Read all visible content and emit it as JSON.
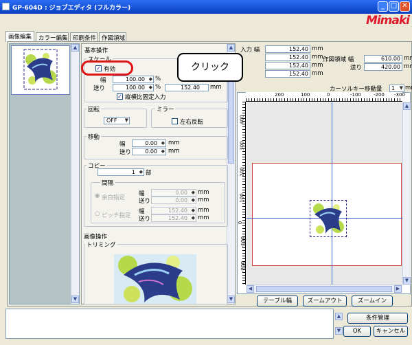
{
  "window": {
    "title": "GP-604D : ジョブエディタ (フルカラー)",
    "brand": "Mimaki"
  },
  "tabs": [
    "画像編集",
    "カラー編集",
    "印刷条件",
    "作図領域"
  ],
  "base_ops": {
    "title": "基本操作",
    "scale_title": "スケール",
    "enable_label": "有効",
    "width_label": "幅",
    "feed_label": "送り",
    "width_value": "100.00",
    "feed_value": "100.00",
    "feed_mm_value": "152.40",
    "unit_pct": "%",
    "unit_mm": "mm",
    "aspect_label": "縦横比固定入力"
  },
  "rotate": {
    "title": "回転",
    "value": "OFF"
  },
  "mirror": {
    "title": "ミラー",
    "label": "左右反転"
  },
  "move": {
    "title": "移動",
    "width_label": "幅",
    "feed_label": "送り",
    "width_value": "0.00",
    "feed_value": "0.00",
    "unit": "mm"
  },
  "copy": {
    "title": "コピー",
    "count": "1",
    "count_unit": "部",
    "gap_title": "間隔",
    "blank_label": "余白指定",
    "pitch_label": "ピッチ指定",
    "width_label": "幅",
    "feed_label": "送り",
    "blank_w": "0.00",
    "blank_f": "0.00",
    "pitch_w": "152.40",
    "pitch_f": "152.40",
    "unit": "mm"
  },
  "image_ops": {
    "title": "画像操作",
    "trimming": "トリミング"
  },
  "info": {
    "input_label": "入力 幅",
    "input_w": "152.40",
    "r2": "152.40",
    "r3": "152.40",
    "r4": "152.40",
    "unit": "mm",
    "area_label": "作図領域 幅",
    "area_w": "610.00",
    "area_feed_label": "送り",
    "area_f": "420.00",
    "cursor_label": "カーソルキー移動量",
    "cursor_value": "1"
  },
  "ruler": {
    "top": [
      "200",
      "100",
      "0",
      "-100",
      "-200",
      "-300"
    ],
    "left": [
      "400",
      "300",
      "200",
      "100",
      "0",
      "-100",
      "-200"
    ]
  },
  "preview_buttons": [
    "テーブル幅",
    "ズームアウト",
    "ズームイン"
  ],
  "footer": {
    "conditions": "条件管理",
    "ok": "OK",
    "cancel": "キャンセル"
  },
  "callout": {
    "text": "クリック"
  }
}
